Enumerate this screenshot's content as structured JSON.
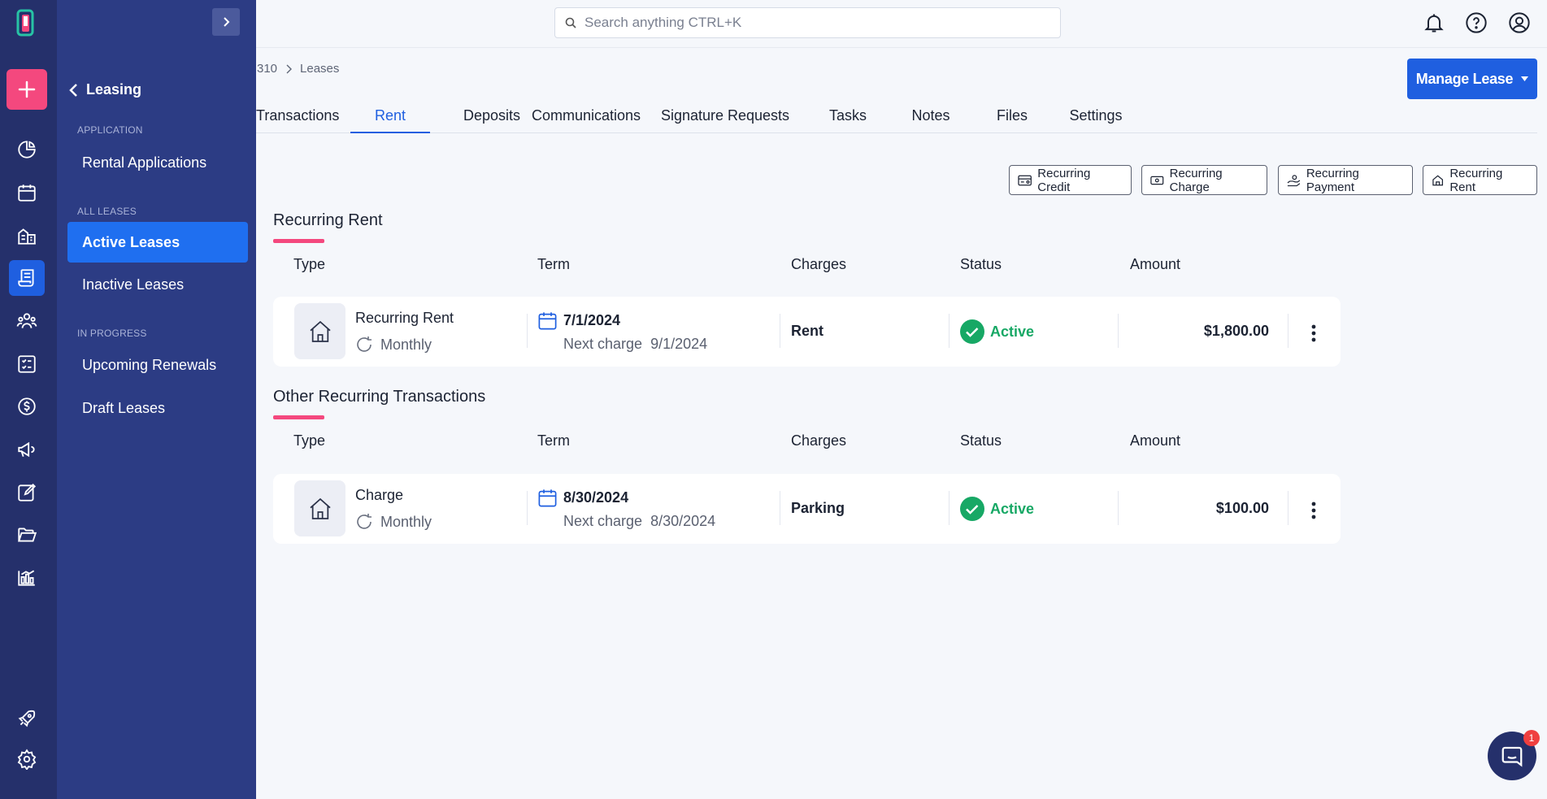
{
  "search": {
    "placeholder": "Search anything CTRL+K"
  },
  "sidebar": {
    "back_label": "Leasing",
    "sections": [
      {
        "label": "APPLICATION",
        "items": [
          "Rental Applications"
        ]
      },
      {
        "label": "ALL LEASES",
        "items": [
          "Active Leases",
          "Inactive Leases"
        ]
      },
      {
        "label": "IN PROGRESS",
        "items": [
          "Upcoming Renewals",
          "Draft Leases"
        ]
      }
    ],
    "active_item": "Active Leases"
  },
  "breadcrumb": {
    "parent": "310",
    "current": "Leases"
  },
  "manage_button": "Manage Lease",
  "tabs": [
    "Transactions",
    "Rent",
    "Deposits",
    "Communications",
    "Signature Requests",
    "Tasks",
    "Notes",
    "Files",
    "Settings"
  ],
  "active_tab": "Rent",
  "actions": [
    "Recurring Credit",
    "Recurring Charge",
    "Recurring Payment",
    "Recurring Rent"
  ],
  "columns": {
    "type": "Type",
    "term": "Term",
    "charges": "Charges",
    "status": "Status",
    "amount": "Amount"
  },
  "recurring_rent": {
    "title": "Recurring Rent",
    "rows": [
      {
        "type": "Recurring Rent",
        "frequency": "Monthly",
        "date": "7/1/2024",
        "next_label": "Next charge",
        "next_date": "9/1/2024",
        "charge": "Rent",
        "status": "Active",
        "amount": "$1,800.00"
      }
    ]
  },
  "other": {
    "title": "Other Recurring Transactions",
    "rows": [
      {
        "type": "Charge",
        "frequency": "Monthly",
        "date": "8/30/2024",
        "next_label": "Next charge",
        "next_date": "8/30/2024",
        "charge": "Parking",
        "status": "Active",
        "amount": "$100.00"
      }
    ]
  },
  "chat": {
    "badge": "1"
  },
  "colors": {
    "rail": "#25306b",
    "sidebar": "#2c3c84",
    "primary": "#1f5fe0",
    "accent": "#f4487e",
    "success": "#17a865"
  }
}
